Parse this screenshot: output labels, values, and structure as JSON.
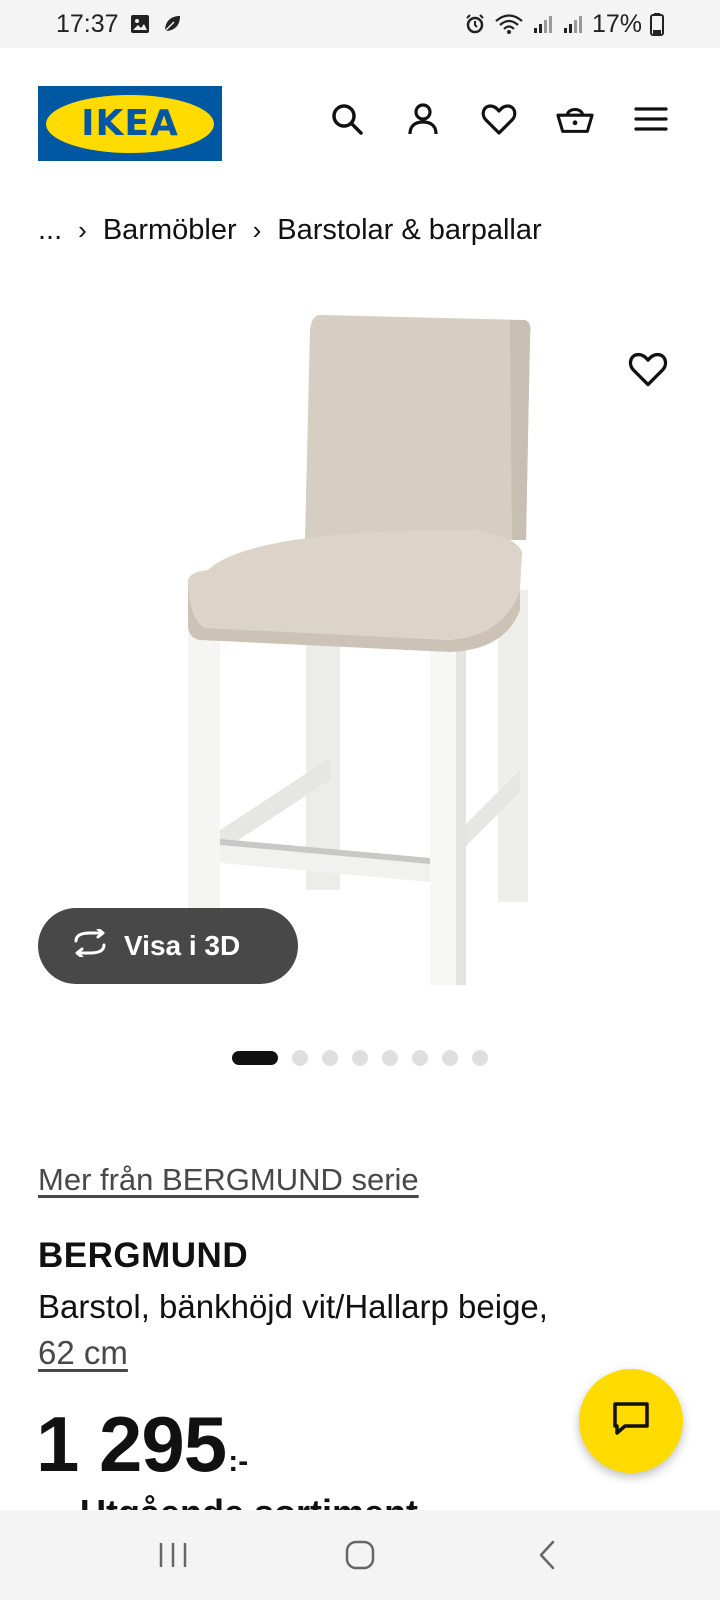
{
  "status_bar": {
    "time": "17:37",
    "battery": "17%",
    "icons": [
      "gallery-icon",
      "leaf-icon",
      "alarm-icon",
      "wifi-icon",
      "signal-icon",
      "signal-icon",
      "battery-icon"
    ]
  },
  "header": {
    "logo_text": "IKEA",
    "icons": [
      "search-icon",
      "account-icon",
      "heart-icon",
      "basket-icon",
      "menu-icon"
    ]
  },
  "breadcrumb": {
    "items": [
      "...",
      "Barmöbler",
      "Barstolar & barpallar"
    ]
  },
  "gallery": {
    "view_3d_label": "Visa i 3D",
    "total_images": 8,
    "active_index": 0
  },
  "product": {
    "series_link": "Mer från BERGMUND serie",
    "name": "BERGMUND",
    "description": "Barstol, bänkhöjd vit/Hallarp beige,",
    "size": "62 cm",
    "price": "1 295",
    "price_suffix": ":-",
    "next_line_partial": "Utgående sortiment"
  },
  "colors": {
    "ikea_blue": "#0058a3",
    "ikea_yellow": "#ffdb00",
    "button_dark": "#484848",
    "seat_beige": "#d9d1c5",
    "frame_white": "#f3f3f1"
  }
}
